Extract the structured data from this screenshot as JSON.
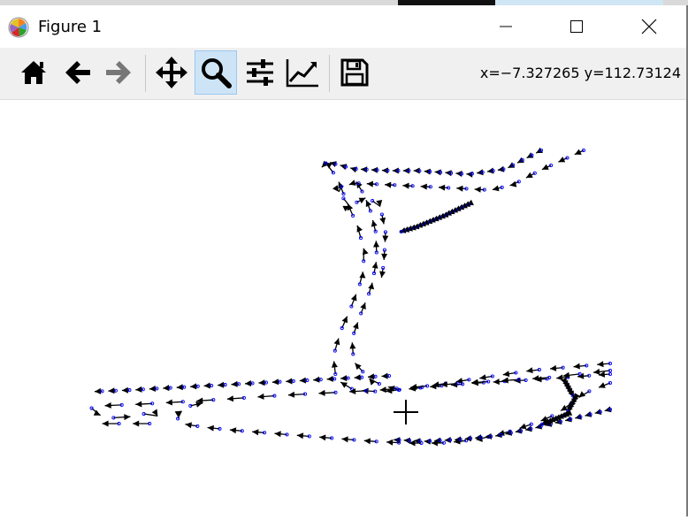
{
  "window": {
    "title": "Figure 1"
  },
  "toolbar": {
    "buttons": [
      {
        "name": "home-button",
        "icon": "home-icon"
      },
      {
        "name": "back-button",
        "icon": "arrow-left-icon"
      },
      {
        "name": "forward-button",
        "icon": "arrow-right-icon"
      },
      {
        "name": "pan-button",
        "icon": "move-icon"
      },
      {
        "name": "zoom-button",
        "icon": "magnifier-icon",
        "active": true
      },
      {
        "name": "configure-subplots-button",
        "icon": "sliders-icon"
      },
      {
        "name": "edit-axes-button",
        "icon": "line-chart-icon"
      },
      {
        "name": "save-button",
        "icon": "floppy-disk-icon"
      }
    ],
    "coords_text": "x=−7.327265 y=112.73124"
  },
  "colors": {
    "toolbar_bg": "#f0f0f0",
    "active_bg": "#cde4f7",
    "point_color": "#0000ff",
    "arrow_color": "#000000"
  }
}
